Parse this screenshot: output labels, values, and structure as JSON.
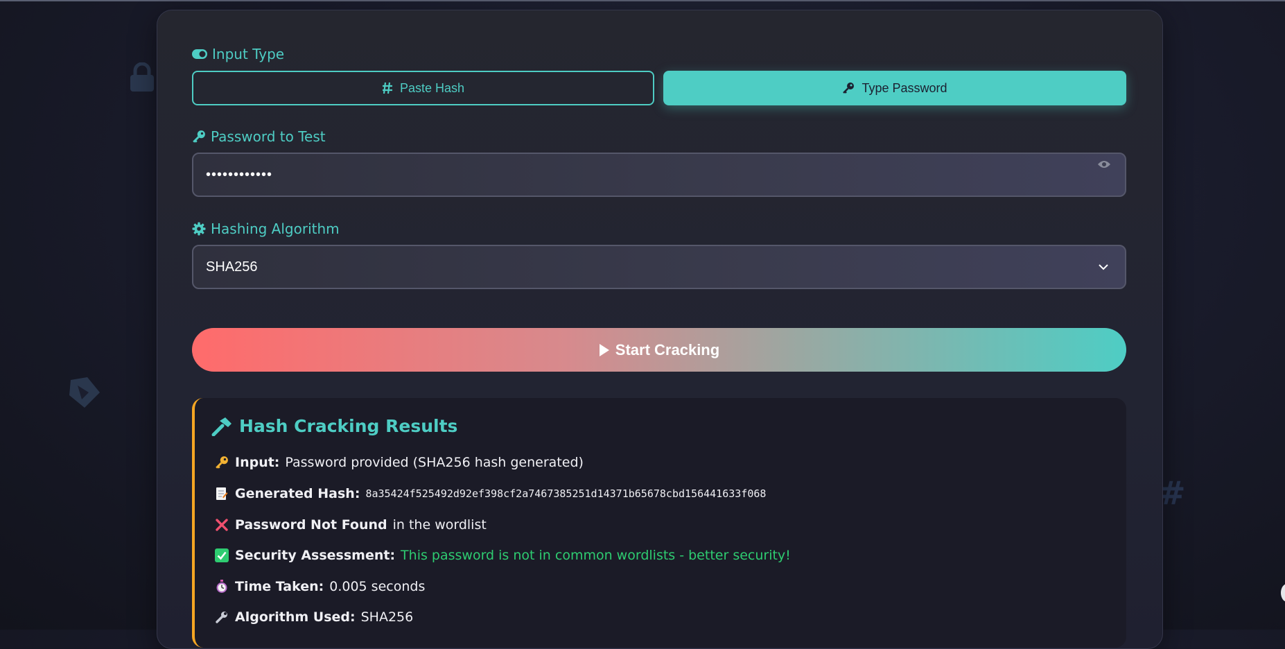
{
  "input_type": {
    "label": "Input Type",
    "options": [
      "Paste Hash",
      "Type Password"
    ],
    "selected": "Type Password"
  },
  "password_field": {
    "label": "Password to Test",
    "value": "••••••••••••"
  },
  "algorithm": {
    "label": "Hashing Algorithm",
    "selected": "SHA256"
  },
  "start_button": "Start Cracking",
  "results": {
    "title": "Hash Cracking Results",
    "input_label": "Input:",
    "input_value": "Password provided (SHA256 hash generated)",
    "hash_label": "Generated Hash:",
    "hash_value": "8a35424f525492d92ef398cf2a7467385251d14371b65678cbd156441633f068",
    "not_found_label": "Password Not Found",
    "not_found_suffix": "in the wordlist",
    "security_label": "Security Assessment:",
    "security_value": "This password is not in common wordlists - better security!",
    "time_label": "Time Taken:",
    "time_value": "0.005 seconds",
    "algo_label": "Algorithm Used:",
    "algo_value": "SHA256"
  },
  "colors": {
    "accent": "#4ecdc4",
    "gradient_start": "#ff6b6b",
    "results_border": "#f5a623",
    "success": "#2ecc71"
  },
  "icons": [
    "toggle-icon",
    "hashtag-icon",
    "key-icon",
    "eye-icon",
    "gear-icon",
    "chevron-down-icon",
    "play-icon",
    "hammer-icon",
    "cross-icon",
    "check-icon",
    "stopwatch-icon",
    "wrench-icon",
    "memo-icon"
  ]
}
